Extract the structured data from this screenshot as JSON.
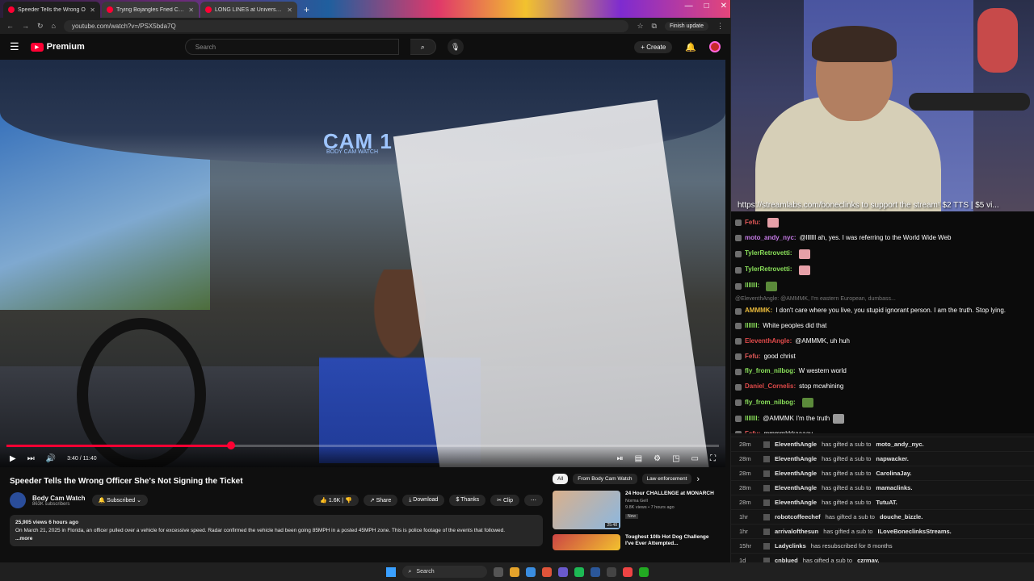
{
  "browser": {
    "tabs": [
      {
        "label": "Speeder Tells the Wrong O"
      },
      {
        "label": "Trying Bojangles Fried Chicken"
      },
      {
        "label": "LONG LINES at Universal Studi"
      }
    ],
    "url": "youtube.com/watch?v=/PSX5bda7Q",
    "finish_update": "Finish update"
  },
  "youtube": {
    "brand": "Premium",
    "search_placeholder": "Search",
    "create_label": "Create",
    "player": {
      "cam_text": "CAM 1",
      "cam_subtext": "BODY CAM WATCH",
      "time": "3:40 / 11:40",
      "progress_fraction": 0.315
    },
    "video_title": "Speeder Tells the Wrong Officer She's Not Signing the Ticket",
    "channel": {
      "name": "Body Cam Watch",
      "subs": "863K subscribers",
      "subscribed_label": "Subscribed"
    },
    "actions": {
      "likes": "1.6K",
      "share": "Share",
      "download": "Download",
      "thanks": "Thanks",
      "clip": "Clip"
    },
    "description": {
      "meta": "25,905 views  6 hours ago",
      "text": "On March 21, 2025 in Florida, an officer pulled over a vehicle for excessive speed. Radar confirmed the vehicle had been going 85MPH in a posted 45MPH zone. This is police footage of the events that followed.",
      "more": "...more"
    },
    "chips": [
      "All",
      "From Body Cam Watch",
      "Law enforcement"
    ],
    "recommendations": [
      {
        "title": "24 Hour CHALLENGE at MONARCH",
        "channel": "Norma Gell",
        "stats": "9.8K views • 7 hours ago",
        "badge": "New",
        "duration": "25:48"
      },
      {
        "title": "Toughest 10lb Hot Dog Challenge I've Ever Attempted...",
        "channel": "",
        "stats": "",
        "badge": "",
        "duration": ""
      }
    ]
  },
  "stream": {
    "ticker": "https://streamlabs.com/boneclinks to support the stream! $2 TTS | $5 vi..."
  },
  "chat": [
    {
      "user": "Fefu:",
      "color": "#e05858",
      "text": "",
      "emote": "pink"
    },
    {
      "user": "moto_andy_nyc:",
      "color": "#c57ae6",
      "text": "@lllllll ah, yes. I was referring to the World Wide Web"
    },
    {
      "user": "TylerRetrovetti:",
      "color": "#8ae05a",
      "text": "",
      "emote": "pink"
    },
    {
      "user": "TylerRetrovetti:",
      "color": "#8ae05a",
      "text": "",
      "emote": "pink"
    },
    {
      "user": "lllllll:",
      "color": "#8ae05a",
      "text": "",
      "emote": "green"
    },
    {
      "reply": "@EleventhAngle: @AMMMK, I'm eastern European, dumbass..."
    },
    {
      "user": "AMMMK:",
      "color": "#e8b93a",
      "text": "I don't care where you live, you stupid ignorant person. I am the truth. Stop lying."
    },
    {
      "user": "lllllll:",
      "color": "#8ae05a",
      "text": "White peoples did that"
    },
    {
      "user": "EleventhAngle:",
      "color": "#e04a4a",
      "text": "@AMMMK, uh huh"
    },
    {
      "user": "Fefu:",
      "color": "#e05858",
      "text": "good christ"
    },
    {
      "user": "fly_from_nilbog:",
      "color": "#8ae05a",
      "text": "W western world"
    },
    {
      "user": "Daniel_Cornelis:",
      "color": "#e04a4a",
      "text": "stop mcwhining"
    },
    {
      "user": "fly_from_nilbog:",
      "color": "#8ae05a",
      "text": "",
      "emote": "green"
    },
    {
      "user": "lllllll:",
      "color": "#8ae05a",
      "text": "@AMMMK  I'm the truth",
      "emote": "cat"
    },
    {
      "user": "Fefu:",
      "color": "#e05858",
      "text": "mmmmkkkaaaay"
    }
  ],
  "subs": [
    {
      "time": "28m",
      "user": "EleventhAngle",
      "action": "has gifted a sub to",
      "target": "moto_andy_nyc."
    },
    {
      "time": "28m",
      "user": "EleventhAngle",
      "action": "has gifted a sub to",
      "target": "napwacker."
    },
    {
      "time": "28m",
      "user": "EleventhAngle",
      "action": "has gifted a sub to",
      "target": "CarolinaJay."
    },
    {
      "time": "28m",
      "user": "EleventhAngle",
      "action": "has gifted a sub to",
      "target": "mamaclinks."
    },
    {
      "time": "28m",
      "user": "EleventhAngle",
      "action": "has gifted a sub to",
      "target": "TutuAT."
    },
    {
      "time": "1hr",
      "user": "robotcoffeechef",
      "action": "has gifted a sub to",
      "target": "douche_bizzle."
    },
    {
      "time": "1hr",
      "user": "arrivalofthesun",
      "action": "has gifted a sub to",
      "target": "ILoveBoneclinksStreams."
    },
    {
      "time": "15hr",
      "user": "Ladyclinks",
      "action": "has resubscribed for 8 months",
      "target": ""
    },
    {
      "time": "1d",
      "user": "cnblued",
      "action": "has gifted a sub to",
      "target": "czrmay."
    }
  ],
  "taskbar": {
    "search": "Search"
  }
}
